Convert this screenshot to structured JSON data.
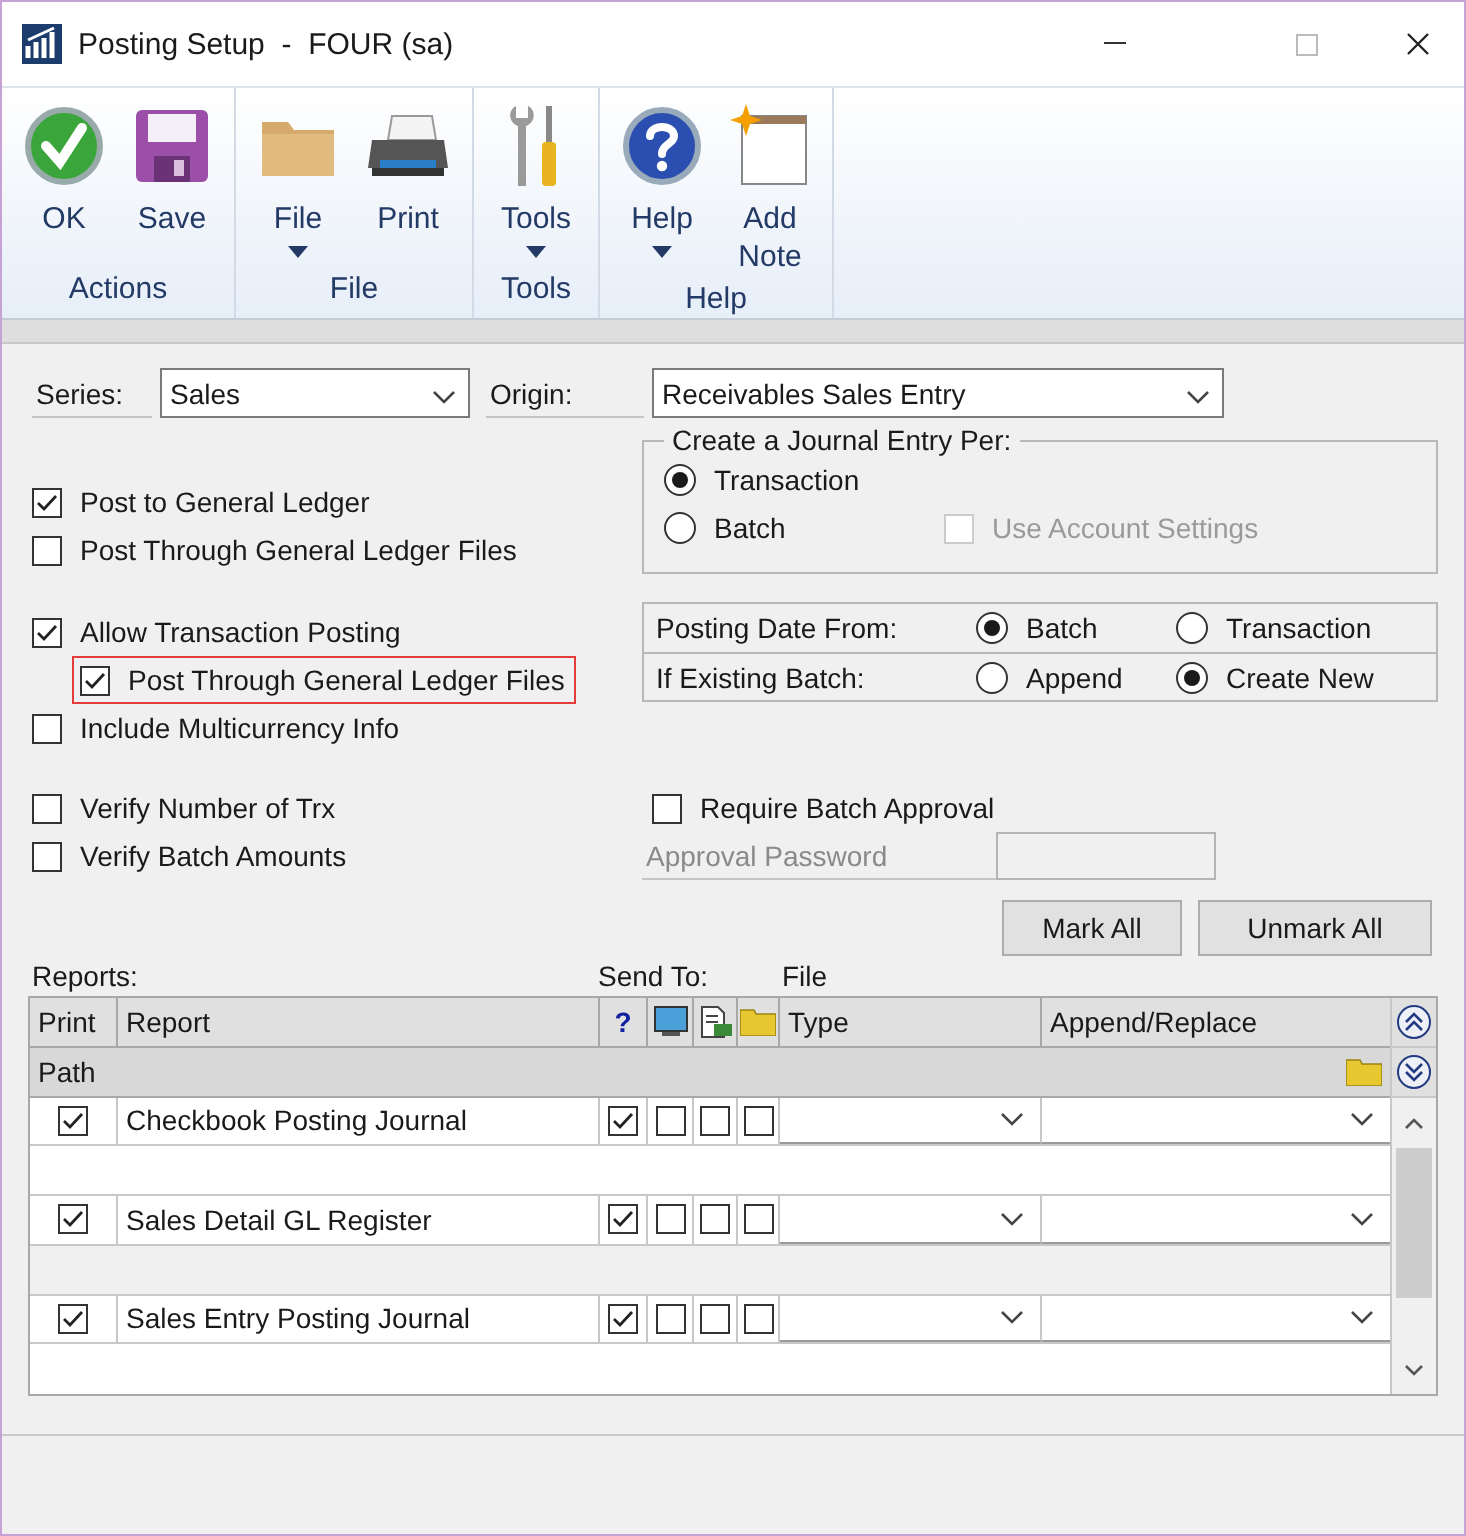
{
  "window": {
    "title": "Posting Setup  -  FOUR (sa)"
  },
  "ribbon": {
    "groups": [
      {
        "label": "Actions",
        "buttons": [
          {
            "label": "OK",
            "kind": "ok",
            "dropdown": false
          },
          {
            "label": "Save",
            "kind": "save",
            "dropdown": false
          }
        ]
      },
      {
        "label": "File",
        "buttons": [
          {
            "label": "File",
            "kind": "folder",
            "dropdown": true
          },
          {
            "label": "Print",
            "kind": "print",
            "dropdown": false
          }
        ]
      },
      {
        "label": "Tools",
        "buttons": [
          {
            "label": "Tools",
            "kind": "tools",
            "dropdown": true
          }
        ]
      },
      {
        "label": "Help",
        "buttons": [
          {
            "label": "Help",
            "kind": "help",
            "dropdown": true
          },
          {
            "label": "Add Note",
            "kind": "note",
            "dropdown": false
          }
        ]
      }
    ]
  },
  "series": {
    "label": "Series:",
    "value": "Sales"
  },
  "origin": {
    "label": "Origin:",
    "value": "Receivables Sales Entry"
  },
  "post_options": [
    {
      "label": "Post to General Ledger",
      "checked": true
    },
    {
      "label": "Post Through General Ledger Files",
      "checked": false
    }
  ],
  "journal_entry_per": {
    "title": "Create a Journal Entry Per:",
    "options": [
      {
        "label": "Transaction",
        "selected": true
      },
      {
        "label": "Batch",
        "selected": false
      }
    ],
    "use_account_settings": {
      "label": "Use Account Settings",
      "checked": false,
      "disabled": true
    }
  },
  "transaction_options": [
    {
      "label": "Allow Transaction Posting",
      "checked": true,
      "children": [
        {
          "label": "Post Through General Ledger Files",
          "checked": true,
          "highlighted": true
        }
      ]
    },
    {
      "label": "Include Multicurrency Info",
      "checked": false
    }
  ],
  "posting_date": [
    {
      "label": "Posting Date From:",
      "options": [
        {
          "label": "Batch",
          "selected": true
        },
        {
          "label": "Transaction",
          "selected": false
        }
      ]
    },
    {
      "label": "If Existing Batch:",
      "options": [
        {
          "label": "Append",
          "selected": false
        },
        {
          "label": "Create New",
          "selected": true
        }
      ]
    }
  ],
  "verify_options": [
    {
      "label": "Verify Number of Trx",
      "checked": false
    },
    {
      "label": "Verify Batch Amounts",
      "checked": false
    }
  ],
  "batch_approval": {
    "label": "Require Batch Approval",
    "checked": false,
    "password_label": "Approval Password",
    "password_disabled": true
  },
  "buttons": [
    "Mark All",
    "Unmark All"
  ],
  "reports": {
    "label": "Reports:",
    "send_to_label": "Send To:",
    "file_label": "File",
    "columns": {
      "print": "Print",
      "report": "Report",
      "help": "?",
      "type": "Type",
      "append_replace": "Append/Replace"
    },
    "path_label": "Path",
    "rows": [
      {
        "print": true,
        "report": "Checkbook Posting Journal",
        "send_to": [
          true,
          false,
          false,
          false
        ]
      },
      {
        "print": true,
        "report": "Sales Detail GL Register",
        "send_to": [
          true,
          false,
          false,
          false
        ]
      },
      {
        "print": true,
        "report": "Sales Entry Posting Journal",
        "send_to": [
          true,
          false,
          false,
          false
        ]
      }
    ]
  }
}
